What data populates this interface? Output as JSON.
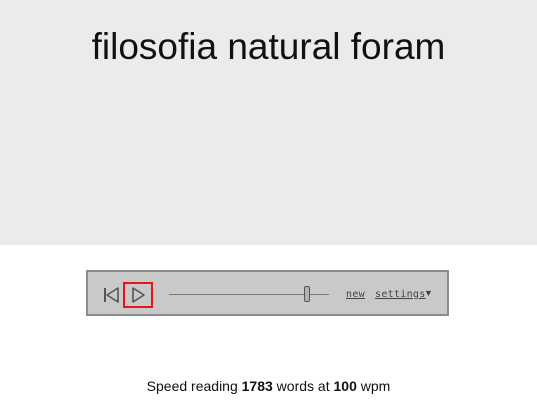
{
  "reader": {
    "current_words": "filosofia natural foram"
  },
  "controls": {
    "rewind_icon": "skip-to-start-icon",
    "play_icon": "play-icon",
    "speed_slider_level": 0.86,
    "new_label": "new",
    "settings_label": "settings",
    "settings_caret": "▼"
  },
  "status": {
    "prefix": "Speed reading ",
    "word_count": "1783",
    "middle": " words at ",
    "wpm": "100",
    "suffix": " wpm"
  },
  "colors": {
    "reading_background": "#eaebea",
    "controls_background": "#c9c9c9",
    "play_highlight": "#e8141a"
  }
}
